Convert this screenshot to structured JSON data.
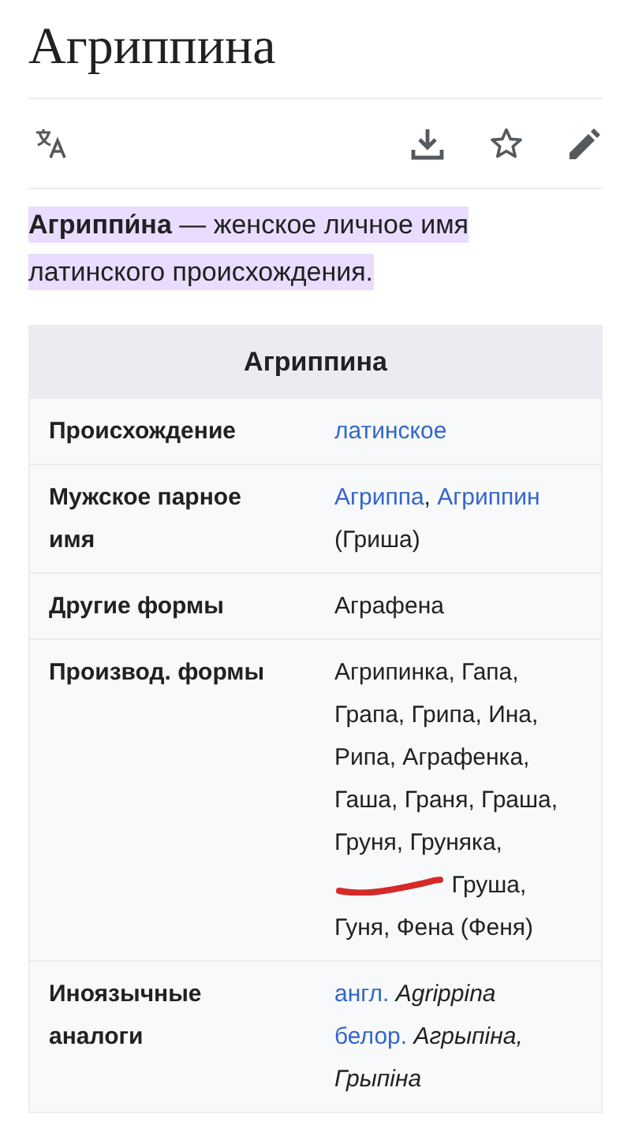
{
  "title": "Агриппина",
  "toolbar": [
    {
      "kind": "translate"
    },
    {
      "kind": "download"
    },
    {
      "kind": "star"
    },
    {
      "kind": "edit"
    }
  ],
  "lead": "**Агриппи́на** — женское личное имя латинского происхождения.",
  "infobox": {
    "title": "Агриппина",
    "rows": [
      {
        "label": "Происхождение",
        "parts": [
          {
            "kind": "link",
            "text": "латинское"
          }
        ]
      },
      {
        "label": "Мужское парное имя",
        "parts": [
          {
            "kind": "link",
            "text": "Агриппа"
          },
          {
            "kind": "plain",
            "text": ", "
          },
          {
            "kind": "link",
            "text": "Агриппин"
          },
          {
            "kind": "plain",
            "text": " (Гриша)"
          }
        ]
      },
      {
        "label": "Другие формы",
        "parts": [
          {
            "kind": "plain",
            "text": "Аграфена"
          }
        ]
      },
      {
        "label": "Производ. формы",
        "parts": [
          {
            "kind": "plain",
            "text": "Агрипинка, Гапа, Грапа, Грипа, Ина, Рипа, Аграфенка, Гаша, Граня, Граша, Груня, Груняка,"
          },
          {
            "kind": "marker"
          },
          {
            "kind": "plain",
            "text": "Груша,"
          },
          {
            "kind": "break"
          },
          {
            "kind": "plain",
            "text": "Гуня, Фена (Феня)"
          }
        ]
      },
      {
        "label": "Иноязычные аналоги",
        "parts": [
          {
            "kind": "link",
            "text": "англ."
          },
          {
            "kind": "italic",
            "text": "Agrippina"
          },
          {
            "kind": "break"
          },
          {
            "kind": "link",
            "text": "белор."
          },
          {
            "kind": "italic",
            "text": "Агрыпіна,"
          },
          {
            "kind": "break"
          },
          {
            "kind": "italic",
            "text": "Грыпіна"
          }
        ]
      }
    ]
  }
}
